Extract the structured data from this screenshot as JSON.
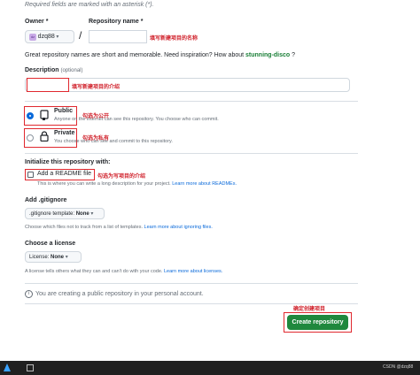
{
  "header": {
    "required_note": "Required fields are marked with an asterisk (*)."
  },
  "owner": {
    "label": "Owner *",
    "value": "dzq88",
    "avatar_text": "dz"
  },
  "repo": {
    "label": "Repository name *",
    "value": "",
    "annotation": "填写新建项目的名称"
  },
  "slash": "/",
  "inspiration": {
    "text": "Great repository names are short and memorable. Need inspiration? How about ",
    "suggestion": "stunning-disco",
    "end": " ?"
  },
  "description": {
    "label": "Description",
    "optional": "(optional)",
    "value": "",
    "annotation": "填写新建项目的介绍"
  },
  "visibility": {
    "public": {
      "title": "Public",
      "desc": "Anyone on the internet can see this repository. You choose who can commit.",
      "annotation": "勾选为公开",
      "selected": true
    },
    "private": {
      "title": "Private",
      "desc": "You choose who can see and commit to this repository.",
      "annotation": "勾选为私有",
      "selected": false
    }
  },
  "init": {
    "heading": "Initialize this repository with:",
    "readme_label": "Add a README file",
    "readme_annotation": "勾选为写项目的介绍",
    "readme_help": "This is where you can write a long description for your project. ",
    "readme_link": "Learn more about READMEs."
  },
  "gitignore": {
    "heading": "Add .gitignore",
    "select_prefix": ".gitignore template: ",
    "select_value": "None",
    "help": "Choose which files not to track from a list of templates. ",
    "link": "Learn more about ignoring files."
  },
  "license": {
    "heading": "Choose a license",
    "select_prefix": "License: ",
    "select_value": "None",
    "help": "A license tells others what they can and can't do with your code. ",
    "link": "Learn more about licenses."
  },
  "notice": {
    "text": "You are creating a public repository in your personal account."
  },
  "create": {
    "label": "Create repository",
    "annotation": "确定创建项目"
  },
  "taskbar": {
    "watermark": "CSDN @dzq88"
  },
  "colors": {
    "primary": "#1f883d",
    "annotation_red": "#e0282e",
    "link": "#0969da"
  }
}
